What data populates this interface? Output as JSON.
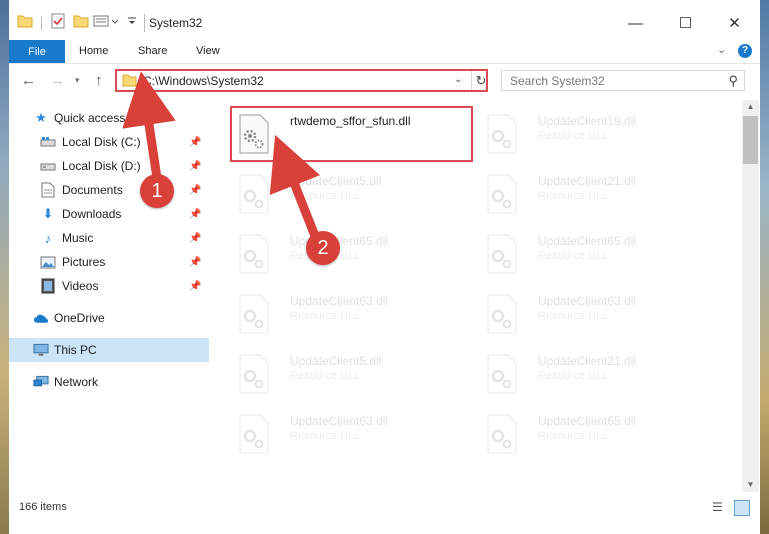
{
  "window": {
    "title": "System32",
    "controls": {
      "minimize": "—",
      "maximize": "☐",
      "close": "✕"
    }
  },
  "ribbon": {
    "tabs": [
      {
        "label": "File"
      },
      {
        "label": "Home"
      },
      {
        "label": "Share"
      },
      {
        "label": "View"
      }
    ],
    "help": "?"
  },
  "address_bar": {
    "path": "C:\\Windows\\System32"
  },
  "search": {
    "placeholder": "Search System32"
  },
  "sidebar": {
    "items": [
      {
        "label": "Quick access",
        "icon": "star-icon"
      },
      {
        "label": "Local Disk (C:)",
        "icon": "drive-icon",
        "pinned": true
      },
      {
        "label": "Local Disk (D:)",
        "icon": "drive-icon",
        "pinned": true
      },
      {
        "label": "Documents",
        "icon": "documents-icon",
        "pinned": true
      },
      {
        "label": "Downloads",
        "icon": "downloads-icon",
        "pinned": true
      },
      {
        "label": "Music",
        "icon": "music-icon",
        "pinned": true
      },
      {
        "label": "Pictures",
        "icon": "pictures-icon",
        "pinned": true
      },
      {
        "label": "Videos",
        "icon": "videos-icon",
        "pinned": true
      },
      {
        "label": "OneDrive",
        "icon": "cloud-icon"
      },
      {
        "label": "This PC",
        "icon": "computer-icon",
        "selected": true
      },
      {
        "label": "Network",
        "icon": "network-icon"
      }
    ]
  },
  "files": [
    {
      "name": "rtwdemo_sffor_sfun.dll",
      "type": ""
    },
    {
      "name": "UpdateClient19.dll",
      "type": "Resource DLL"
    },
    {
      "name": "UpdateClient5.dll",
      "type": "Resource DLL"
    },
    {
      "name": "UpdateClient21.dll",
      "type": "Resource DLL"
    },
    {
      "name": "UpdateClient65.dll",
      "type": "Resource DLL"
    },
    {
      "name": "UpdateClient65.dll",
      "type": "Resource DLL"
    },
    {
      "name": "UpdateClient63.dll",
      "type": "Resource DLL"
    },
    {
      "name": "UpdateClient63.dll",
      "type": "Resource DLL"
    },
    {
      "name": "UpdateClient5.dll",
      "type": "Resource DLL"
    },
    {
      "name": "UpdateClient21.dll",
      "type": "Resource DLL"
    },
    {
      "name": "UpdateClient63.dll",
      "type": "Resource DLL"
    },
    {
      "name": "UpdateClient65.dll",
      "type": "Resource DLL"
    }
  ],
  "status": {
    "item_count": "166 items"
  },
  "annotations": {
    "step1": "1",
    "step2": "2"
  },
  "colors": {
    "accent": "#1979ca",
    "highlight": "#d94a52",
    "selection": "#cce4f7",
    "callout": "#d9403a"
  }
}
